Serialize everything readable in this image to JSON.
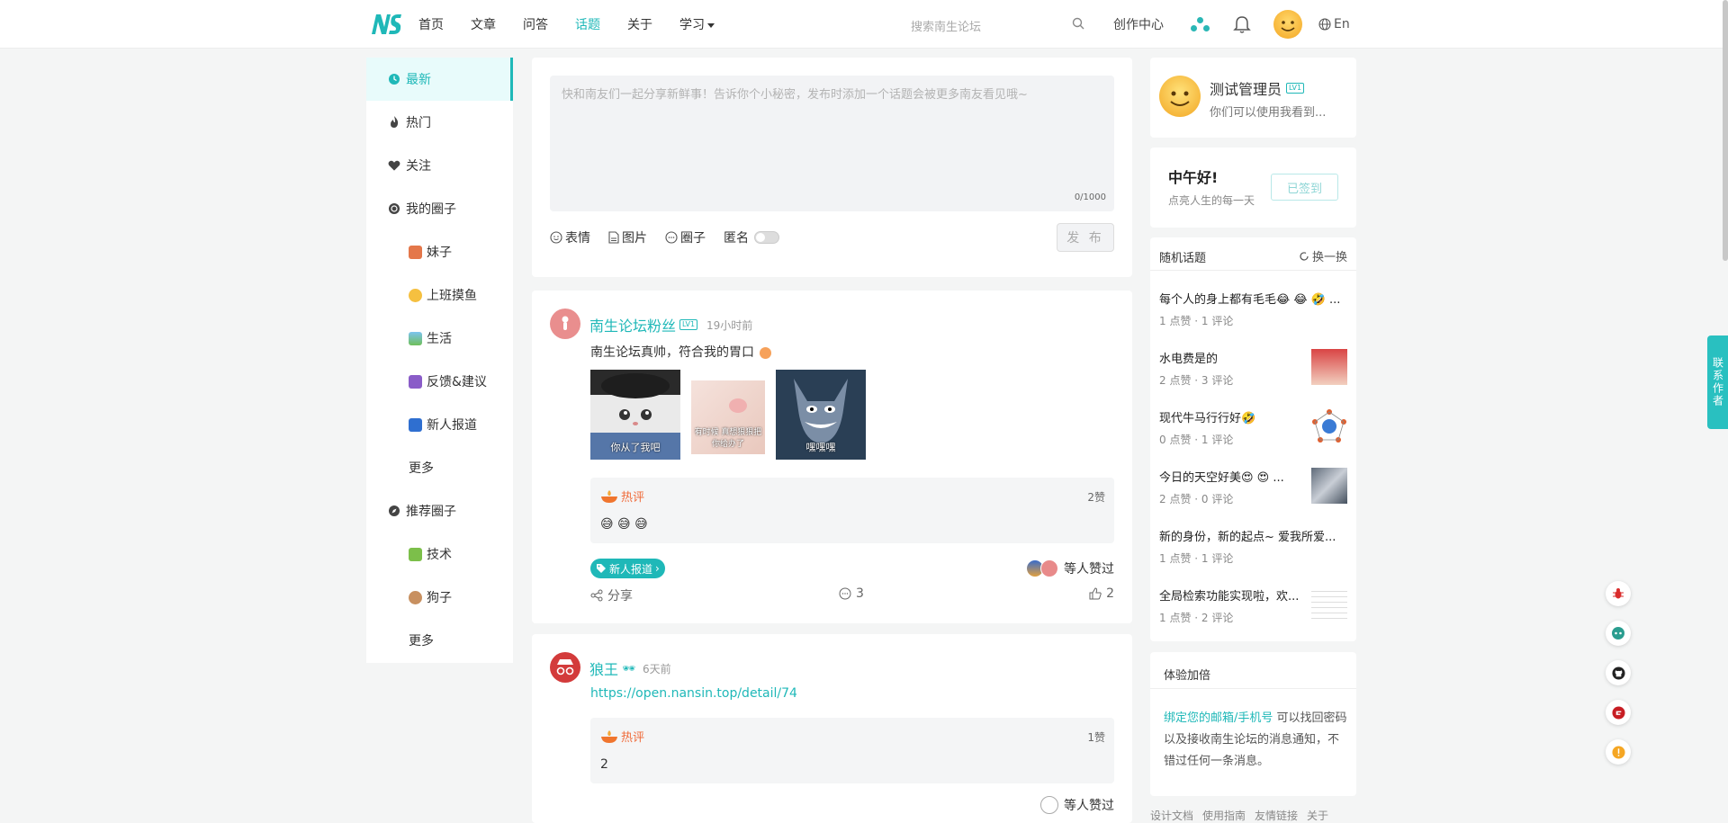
{
  "nav": {
    "items": [
      {
        "label": "首页",
        "active": false
      },
      {
        "label": "文章",
        "active": false
      },
      {
        "label": "问答",
        "active": false
      },
      {
        "label": "话题",
        "active": true
      },
      {
        "label": "关于",
        "active": false
      },
      {
        "label": "学习",
        "active": false,
        "dropdown": true
      }
    ],
    "search_placeholder": "搜索南生论坛",
    "create_center": "创作中心",
    "lang": "En",
    "accent": "#1fb8b8"
  },
  "sidebar": {
    "items": [
      {
        "label": "最新",
        "icon": "clock-icon",
        "active": true
      },
      {
        "label": "热门",
        "icon": "flame-icon"
      },
      {
        "label": "关注",
        "icon": "heart-icon"
      },
      {
        "label": "我的圈子",
        "icon": "circle-icon"
      },
      {
        "label": "妹子",
        "sub": true
      },
      {
        "label": "上班摸鱼",
        "sub": true
      },
      {
        "label": "生活",
        "sub": true
      },
      {
        "label": "反馈&建议",
        "sub": true
      },
      {
        "label": "新人报道",
        "sub": true
      },
      {
        "label": "更多",
        "sub": true
      },
      {
        "label": "推荐圈子",
        "icon": "compass-icon"
      },
      {
        "label": "技术",
        "sub": true
      },
      {
        "label": "狗子",
        "sub": true
      },
      {
        "label": "更多",
        "sub": true
      }
    ]
  },
  "composer": {
    "placeholder": "快和南友们一起分享新鲜事！告诉你个小秘密，发布时添加一个话题会被更多南友看见哦~",
    "count": "0/1000",
    "tools": {
      "emoji": "表情",
      "image": "图片",
      "circle": "圈子",
      "anonymous": "匿名"
    },
    "publish": "发 布"
  },
  "posts": [
    {
      "author": "南生论坛粉丝",
      "badge": "LV1",
      "time": "19小时前",
      "text": "南生论坛真帅，符合我的胃口",
      "images": [
        {
          "caption": "你从了我吧"
        },
        {
          "caption": "有时候 真想狠狠把你给办了"
        },
        {
          "caption": "嘿嘿嘿"
        }
      ],
      "hot_label": "热评",
      "hot_likes": "2赞",
      "hot_body": "😅 😅 😅",
      "tag": "新人报道",
      "liked_text": "等人赞过",
      "share": "分享",
      "comments": "3",
      "likes": "2"
    },
    {
      "author": "狼王",
      "time": "6天前",
      "link": "https://open.nansin.top/detail/74",
      "hot_label": "热评",
      "hot_likes": "1赞",
      "hot_body": "2",
      "liked_text": "等人赞过"
    }
  ],
  "user": {
    "name": "测试管理员",
    "badge": "LV1",
    "sub": "你们可以使用我看到..."
  },
  "greeting": {
    "title": "中午好!",
    "sub": "点亮人生的每一天",
    "checkin": "已签到"
  },
  "random_topics": {
    "title": "随机话题",
    "switch": "换一换",
    "items": [
      {
        "title": "每个人的身上都有毛毛😂 😂 🤣 ...",
        "meta": "1 点赞 · 1 评论",
        "thumb": false
      },
      {
        "title": "水电费是的",
        "meta": "2 点赞 · 3 评论",
        "thumb": true
      },
      {
        "title": "现代牛马行行好🤣",
        "meta": "0 点赞 · 1 评论",
        "thumb": true
      },
      {
        "title": "今日的天空好美😍 😍 ...",
        "meta": "2 点赞 · 0 评论",
        "thumb": true
      },
      {
        "title": "新的身份，新的起点~ 爱我所爱...",
        "meta": "1 点赞 · 1 评论",
        "thumb": false
      },
      {
        "title": "全局检索功能实现啦，欢...",
        "meta": "1 点赞 · 2 评论",
        "thumb": true
      }
    ]
  },
  "experience": {
    "title": "体验加倍",
    "highlight": "绑定您的邮箱/手机号",
    "body": "可以找回密码以及接收南生论坛的消息通知，不错过任何一条消息。"
  },
  "footer_links": [
    "设计文档",
    "使用指南",
    "友情链接",
    "关于"
  ],
  "contact_author": "联系作者"
}
